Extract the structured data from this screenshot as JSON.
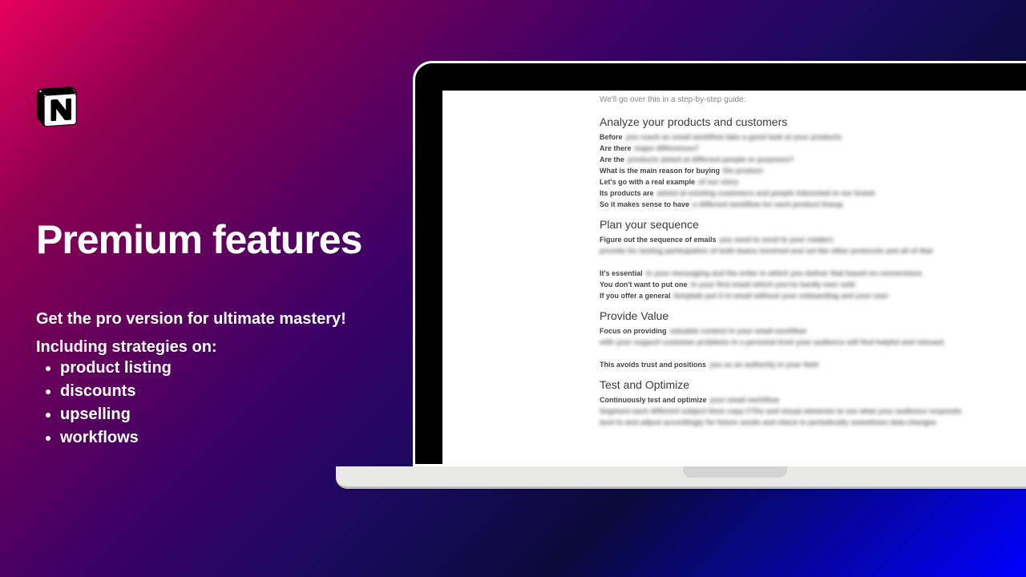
{
  "logo_label": "Notion",
  "title": "Premium features",
  "subtitle": "Get the pro version for ultimate mastery!",
  "strategies_label": "Including strategies on:",
  "strategies": [
    "product listing",
    "discounts",
    "upselling",
    "workflows"
  ],
  "document": {
    "intro": "We'll go over this in a step-by-step guide:",
    "sections": [
      {
        "heading": "Analyze your products and customers",
        "lines": [
          {
            "sharp": "Before",
            "fuzz": "you reach an email workflow take a good look at your products"
          },
          {
            "sharp": "Are there",
            "fuzz": "major differences?"
          },
          {
            "sharp": "Are the",
            "fuzz": "products aimed at different people or purposes?"
          },
          {
            "sharp": "What is the main reason for buying",
            "fuzz": "the product"
          },
          {
            "sharp": "Let's go with a real example",
            "fuzz": "of our story"
          },
          {
            "sharp": "Its products are",
            "fuzz": "aimed at existing customers and people interested in our brand"
          },
          {
            "sharp": "So it makes sense to have",
            "fuzz": "a different workflow for each product lineup"
          }
        ]
      },
      {
        "heading": "Plan your sequence",
        "lines": [
          {
            "sharp": "Figure out the sequence of emails",
            "fuzz": "you need to send to your readers"
          },
          {
            "sharp": "",
            "fuzz": "provide for testing participation of both teams involved and set the other protocols and all of that"
          },
          {
            "sharp": "",
            "fuzz": ""
          },
          {
            "sharp": "It's essential",
            "fuzz": "in your messaging and the order in which you deliver that based on conversions"
          },
          {
            "sharp": "You don't want to put one",
            "fuzz": "in your first email which you've hardly ever sold"
          },
          {
            "sharp": "If you offer a general",
            "fuzz": "template put it in email without your onboarding and your user"
          }
        ]
      },
      {
        "heading": "Provide Value",
        "lines": [
          {
            "sharp": "Focus on providing",
            "fuzz": "valuable content in your email workflow"
          },
          {
            "sharp": "",
            "fuzz": "with your support customer problems in a personal level your audience will find helpful and relevant"
          },
          {
            "sharp": "",
            "fuzz": ""
          },
          {
            "sharp": "This avoids trust and positions",
            "fuzz": "you as an authority in your field"
          }
        ]
      },
      {
        "heading": "Test and Optimize",
        "lines": [
          {
            "sharp": "Continuously test and optimize",
            "fuzz": "your email workflow"
          },
          {
            "sharp": "",
            "fuzz": "Segment each different subject lines copy CTAs and visual elements to see what your audience responds"
          },
          {
            "sharp": "",
            "fuzz": "best to and adjust accordingly for future sends and check in periodically sometimes data changes"
          }
        ]
      }
    ]
  }
}
